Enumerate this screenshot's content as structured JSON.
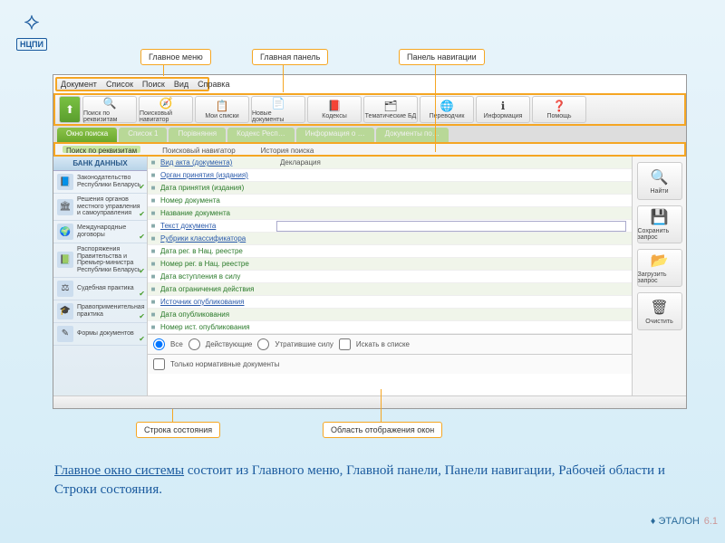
{
  "logo": {
    "label": "НЦПИ"
  },
  "callouts": {
    "main_menu": "Главное меню",
    "main_panel": "Главная панель",
    "nav_panel": "Панель навигации",
    "status_bar": "Строка состояния",
    "display_area": "Область отображения окон"
  },
  "menu": {
    "items": [
      "Документ",
      "Список",
      "Поиск",
      "Вид",
      "Справка"
    ]
  },
  "toolbar": {
    "items": [
      {
        "label": "Поиск по реквизитам",
        "icon": "🔍"
      },
      {
        "label": "Поисковый навигатор",
        "icon": "🧭"
      },
      {
        "label": "Мои списки",
        "icon": "📋"
      },
      {
        "label": "Новые документы",
        "icon": "📄"
      },
      {
        "label": "Кодексы",
        "icon": "📕"
      },
      {
        "label": "Тематические БД",
        "icon": "🗂"
      },
      {
        "label": "Переводчик",
        "icon": "🌐"
      },
      {
        "label": "Информация",
        "icon": "ℹ"
      },
      {
        "label": "Помощь",
        "icon": "❓"
      }
    ]
  },
  "tabs": {
    "items": [
      "Окно поиска",
      "Список 1",
      "Порівняння",
      "Кодекс Респ…",
      "Информация о …",
      "Документы по…"
    ]
  },
  "subtabs": {
    "items": [
      "Поиск по реквизитам",
      "Поисковый навигатор",
      "История поиска"
    ]
  },
  "sidebar": {
    "header": "БАНК ДАННЫХ",
    "items": [
      {
        "label": "Законодательство Республики Беларусь",
        "icon": "📘"
      },
      {
        "label": "Решения органов местного управления и самоуправления",
        "icon": "🏛"
      },
      {
        "label": "Международные договоры",
        "icon": "🌍"
      },
      {
        "label": "Распоряжения Правительства и Премьер-министра Республики Беларусь",
        "icon": "📗"
      },
      {
        "label": "Судебная практика",
        "icon": "⚖"
      },
      {
        "label": "Правоприменительная практика",
        "icon": "🎓"
      },
      {
        "label": "Формы документов",
        "icon": "✎"
      }
    ]
  },
  "form": {
    "rows": [
      {
        "label": "Вид акта (документа)",
        "link": true,
        "value": "Декларация"
      },
      {
        "label": "Орган принятия (издания)",
        "link": true,
        "value": ""
      },
      {
        "label": "Дата принятия (издания)",
        "link": false,
        "value": ""
      },
      {
        "label": "Номер документа",
        "link": false,
        "value": ""
      },
      {
        "label": "Название документа",
        "link": false,
        "value": ""
      },
      {
        "label": "Текст документа",
        "link": true,
        "value": "",
        "input": true
      },
      {
        "label": "Рубрики классификатора",
        "link": true,
        "value": ""
      },
      {
        "label": "Дата рег. в Нац. реестре",
        "link": false,
        "value": ""
      },
      {
        "label": "Номер рег. в Нац. реестре",
        "link": false,
        "value": ""
      },
      {
        "label": "Дата вступления в силу",
        "link": false,
        "value": ""
      },
      {
        "label": "Дата ограничения действия",
        "link": false,
        "value": ""
      },
      {
        "label": "Источник опубликования",
        "link": true,
        "value": ""
      },
      {
        "label": "Дата опубликования",
        "link": false,
        "value": ""
      },
      {
        "label": "Номер ист. опубликования",
        "link": false,
        "value": ""
      }
    ],
    "filters": {
      "all": "Все",
      "active": "Действующие",
      "expired": "Утратившие силу",
      "in_list": "Искать в списке",
      "only_norm": "Только нормативные документы"
    }
  },
  "actions": {
    "find": "Найти",
    "save": "Сохранить запрос",
    "load": "Загрузить запрос",
    "clear": "Очистить"
  },
  "caption": {
    "prefix": "Главное окно системы",
    "rest": " состоит из Главного меню, Главной панели, Панели навигации, Рабочей области и Строки состояния."
  },
  "footer": {
    "brand": "ЭТАЛОН",
    "version": "6.1"
  }
}
